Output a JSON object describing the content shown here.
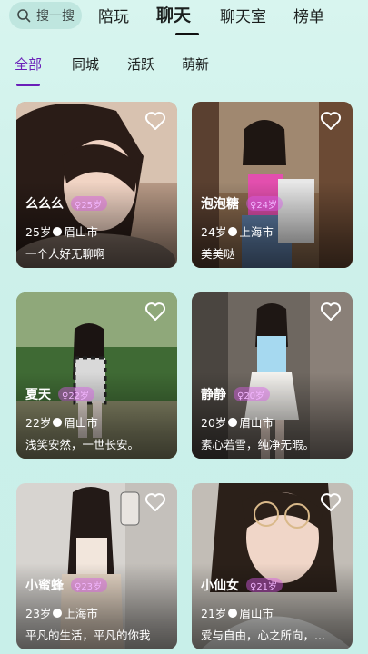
{
  "search": {
    "placeholder": "搜一搜",
    "icon": "search-icon"
  },
  "tabs": [
    {
      "label": "陪玩"
    },
    {
      "label": "聊天"
    },
    {
      "label": "聊天室"
    },
    {
      "label": "榜单"
    }
  ],
  "active_tab": "聊天",
  "subtabs": [
    {
      "label": "全部"
    },
    {
      "label": "同城"
    },
    {
      "label": "活跃"
    },
    {
      "label": "萌新"
    }
  ],
  "active_subtab": "全部",
  "colors": {
    "accent": "#6a1fb8",
    "background": "#d3f2ec",
    "badge": "#e08ff0"
  },
  "cards": [
    {
      "name": "么么么",
      "badge": "♀25岁",
      "age": "25岁",
      "city": "眉山市",
      "bio": "一个人好无聊啊"
    },
    {
      "name": "泡泡糖",
      "badge": "♀24岁",
      "age": "24岁",
      "city": "上海市",
      "bio": "美美哒"
    },
    {
      "name": "夏天",
      "badge": "♀22岁",
      "age": "22岁",
      "city": "眉山市",
      "bio": "浅笑安然，一世长安。"
    },
    {
      "name": "静静",
      "badge": "♀20岁",
      "age": "20岁",
      "city": "眉山市",
      "bio": "素心若雪，纯净无暇。"
    },
    {
      "name": "小蜜蜂",
      "badge": "♀23岁",
      "age": "23岁",
      "city": "上海市",
      "bio": "平凡的生活，平凡的你我"
    },
    {
      "name": "小仙女",
      "badge": "♀21岁",
      "age": "21岁",
      "city": "眉山市",
      "bio": "爱与自由，心之所向，..."
    }
  ]
}
